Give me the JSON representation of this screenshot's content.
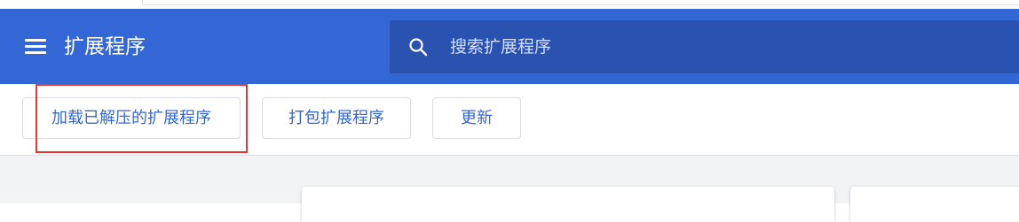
{
  "header": {
    "title": "扩展程序",
    "menu_icon": "hamburger-menu-icon"
  },
  "search": {
    "placeholder": "搜索扩展程序",
    "value": "",
    "icon": "search-icon"
  },
  "toolbar": {
    "load_unpacked_label": "加载已解压的扩展程序",
    "pack_label": "打包扩展程序",
    "update_label": "更新"
  },
  "colors": {
    "header_bg": "#3367d6",
    "search_bg": "#2a52b0",
    "accent": "#3367d6",
    "highlight": "#e53935",
    "content_bg": "#f1f3f4"
  }
}
